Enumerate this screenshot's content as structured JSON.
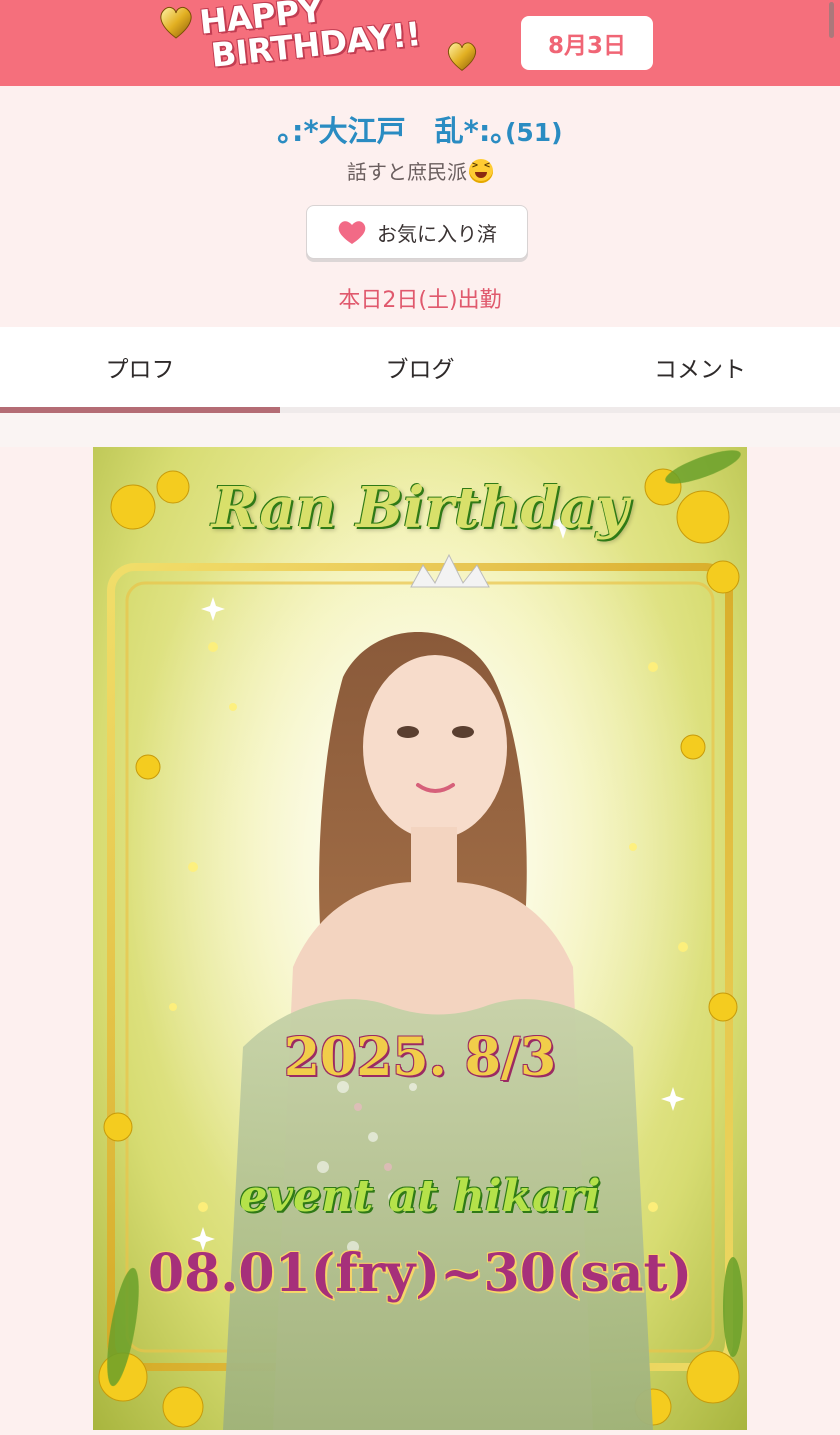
{
  "birthday_banner": {
    "line1": "HAPPY",
    "line2": "BIRTHDAY!!",
    "date": "8月3日",
    "colors": {
      "banner": "#f56f7c",
      "date_text": "#f06575"
    },
    "icons": [
      "gold-heart-icon",
      "gold-heart-icon"
    ]
  },
  "profile": {
    "name": "｡:*大江戸　乱*:｡",
    "age": "(51)",
    "catchphrase": "話すと庶民派",
    "catchphrase_emoji": "grinning-squinting-face-emoji",
    "favorite_button_label": "お気に入り済",
    "favorite_icon": "heart-icon",
    "schedule": "本日2日(土)出勤",
    "colors": {
      "name": "#2a8cc2",
      "schedule": "#e0596d",
      "heart": "#f26a86"
    }
  },
  "tabs": [
    {
      "label": "プロフ",
      "active": true
    },
    {
      "label": "ブログ",
      "active": false
    },
    {
      "label": "コメント",
      "active": false
    }
  ],
  "event_image": {
    "title": "Ran Birthday",
    "date": "2025. 8/3",
    "event": "event at hikari",
    "period": "08.01(fry)~30(sat)"
  }
}
